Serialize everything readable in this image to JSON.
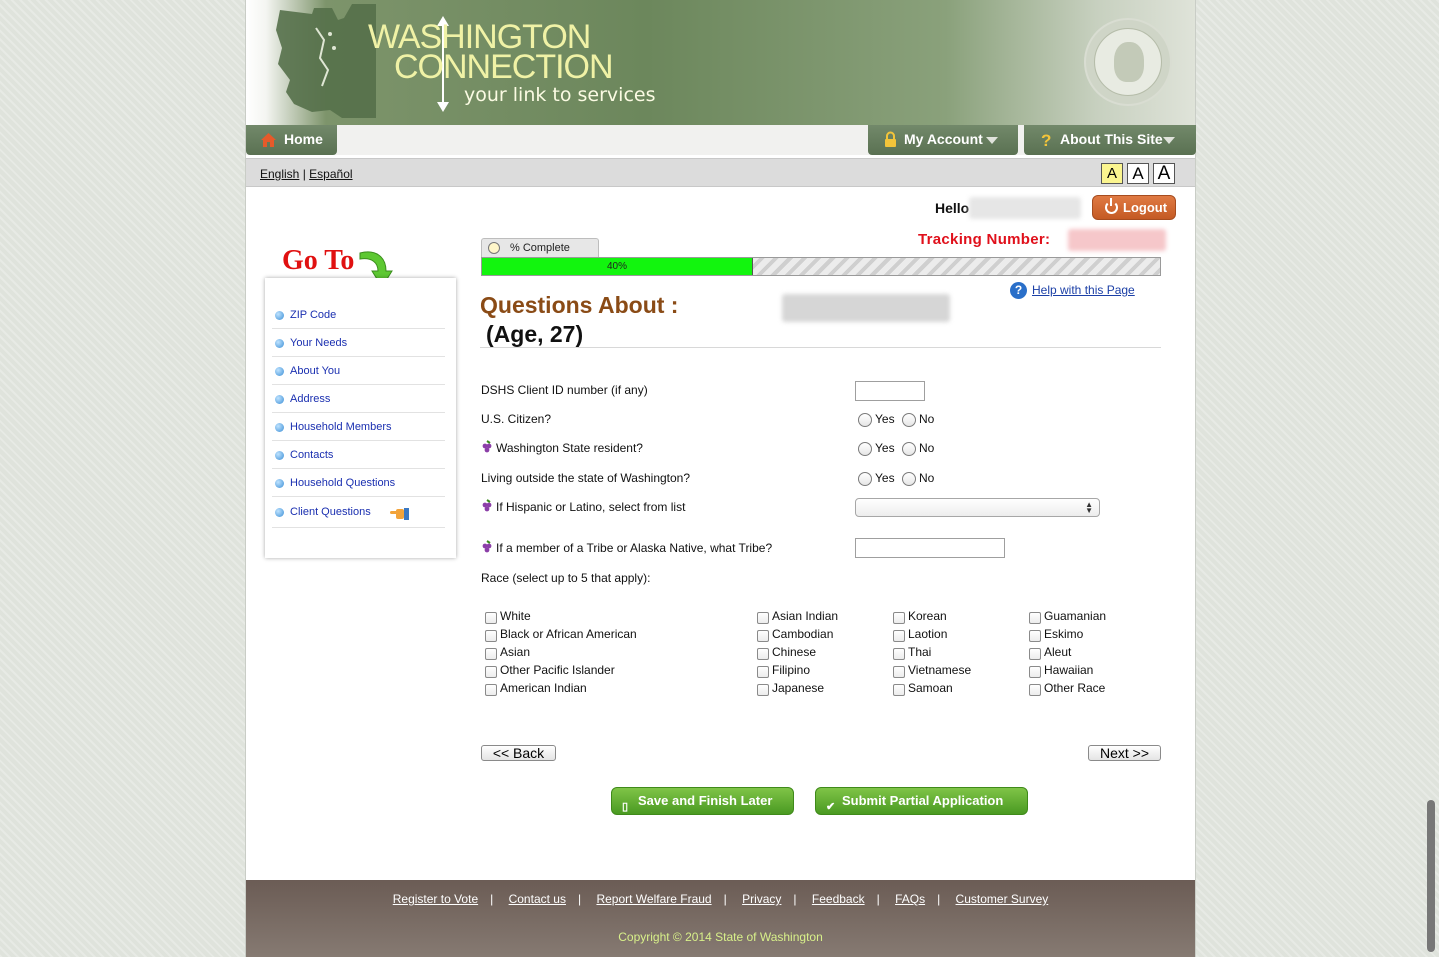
{
  "header": {
    "logo_line1": "WASHINGTON",
    "logo_line2": "CONNECTION",
    "tagline": "your link to services",
    "seal": "state-seal"
  },
  "nav": {
    "home": "Home",
    "my_account": "My Account",
    "about": "About This Site"
  },
  "lang": {
    "english": "English",
    "separator": "|",
    "spanish": "Español"
  },
  "font_sizes": [
    "A",
    "A",
    "A"
  ],
  "user": {
    "hello": "Hello",
    "logout": "Logout",
    "tracking_label": "Tracking Number:"
  },
  "progress": {
    "tab_label": "% Complete",
    "value_label": "40%",
    "fraction": 0.4
  },
  "page": {
    "title": "Questions About :",
    "age": "(Age, 27)",
    "help": "Help with this Page"
  },
  "sidebar": {
    "goto": "Go To",
    "items": [
      {
        "label": "ZIP Code"
      },
      {
        "label": "Your Needs"
      },
      {
        "label": "About You"
      },
      {
        "label": "Address"
      },
      {
        "label": "Household Members"
      },
      {
        "label": "Contacts"
      },
      {
        "label": "Household Questions"
      },
      {
        "label": "Client Questions"
      }
    ]
  },
  "form": {
    "client_id": "DSHS Client ID number (if any)",
    "citizen": "U.S. Citizen?",
    "resident": "Washington State resident?",
    "outside": "Living outside the state of Washington?",
    "hispanic": "If Hispanic or Latino, select from list",
    "tribe": "If a member of a Tribe or Alaska Native, what Tribe?",
    "race": "Race (select up to 5 that apply):",
    "yes": "Yes",
    "no": "No",
    "hispanic_selected": ""
  },
  "race_options": {
    "col1": [
      "White",
      "Black or African American",
      "Asian",
      "Other Pacific Islander",
      "American Indian"
    ],
    "col2": [
      "Asian Indian",
      "Cambodian",
      "Chinese",
      "Filipino",
      "Japanese"
    ],
    "col3": [
      "Korean",
      "Laotion",
      "Thai",
      "Vietnamese",
      "Samoan"
    ],
    "col4": [
      "Guamanian",
      "Eskimo",
      "Aleut",
      "Hawaiian",
      "Other Race"
    ]
  },
  "buttons": {
    "back": "<< Back",
    "next": "Next >>",
    "save": "Save and Finish Later",
    "submit": "Submit Partial Application"
  },
  "footer": {
    "links": [
      "Register to Vote",
      "Contact us",
      "Report Welfare Fraud",
      "Privacy",
      "Feedback",
      "FAQs",
      "Customer Survey"
    ],
    "separator": "|",
    "copyright": "Copyright © 2014 State of Washington"
  },
  "colors": {
    "header_green": "#6c875c",
    "logo_yellow": "#f0f2a6",
    "progress_green": "#12f50e",
    "title_brown": "#8a4b16",
    "tracking_red": "#e0101b",
    "button_green": "#4a9a22",
    "logout_orange": "#c45a24"
  }
}
